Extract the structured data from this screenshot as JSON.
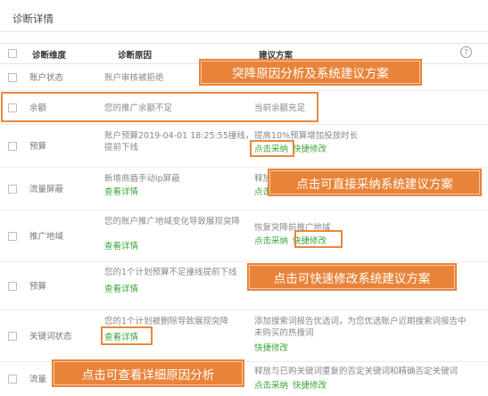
{
  "page": {
    "title": "诊断详情"
  },
  "table": {
    "headers": {
      "dimension": "诊断维度",
      "reason": "诊断原因",
      "plan": "建议方案"
    },
    "help_icon_label": "?",
    "rows": [
      {
        "dimension": "账户状态",
        "reason": "账户审核被拒绝",
        "reason_link": "",
        "plan": "",
        "plan_links": []
      },
      {
        "dimension": "余额",
        "reason": "您的推广余额不足",
        "reason_link": "",
        "plan": "当前余额充足",
        "plan_links": []
      },
      {
        "dimension": "预算",
        "reason": "账户预算2019-04-01 18:25:55撞线，提前下线",
        "reason_link": "",
        "plan": "提高10%预算增加投放时长",
        "plan_links": [
          "点击采纳",
          "快捷修改"
        ]
      },
      {
        "dimension": "流量屏蔽",
        "reason": "新增商盾手动ip屏蔽",
        "reason_link": "查看详情",
        "plan": "释放",
        "plan_links": [
          "点击"
        ]
      },
      {
        "dimension": "推广地域",
        "reason": "您的账户推广地域变化导致展现突降",
        "reason_link": "查看详情",
        "plan": "恢复突降前推广地域",
        "plan_links": [
          "点击采纳",
          "快捷修改"
        ]
      },
      {
        "dimension": "预算",
        "reason": "您的1个计划预算不足撞线提前下线",
        "reason_link": "查看详情",
        "plan": "",
        "plan_links": []
      },
      {
        "dimension": "关键词状态",
        "reason": "您的1个计划被删除导致展现突降",
        "reason_link": "查看详情",
        "plan": "添加搜索词报告优选词，为您优选账户近期搜索词报告中未购买的热搜词",
        "plan_links": [
          "快捷修改"
        ]
      },
      {
        "dimension": "流量",
        "reason": "",
        "reason_link": "",
        "plan": "释放与已购关键词重复的否定关键词和精确否定关键词",
        "plan_links": [
          "点击采纳",
          "快捷修改"
        ]
      }
    ]
  },
  "callouts": {
    "reason_analysis": "突降原因分析及系统建议方案",
    "adopt": "点击可直接采纳系统建议方案",
    "quick_edit": "点击可快速修改系统建议方案",
    "view_details": "点击可查看详细原因分析"
  },
  "colors": {
    "accent_orange": "#e8843a",
    "link_green": "#3aa53a",
    "border": "#e3e3e3"
  }
}
